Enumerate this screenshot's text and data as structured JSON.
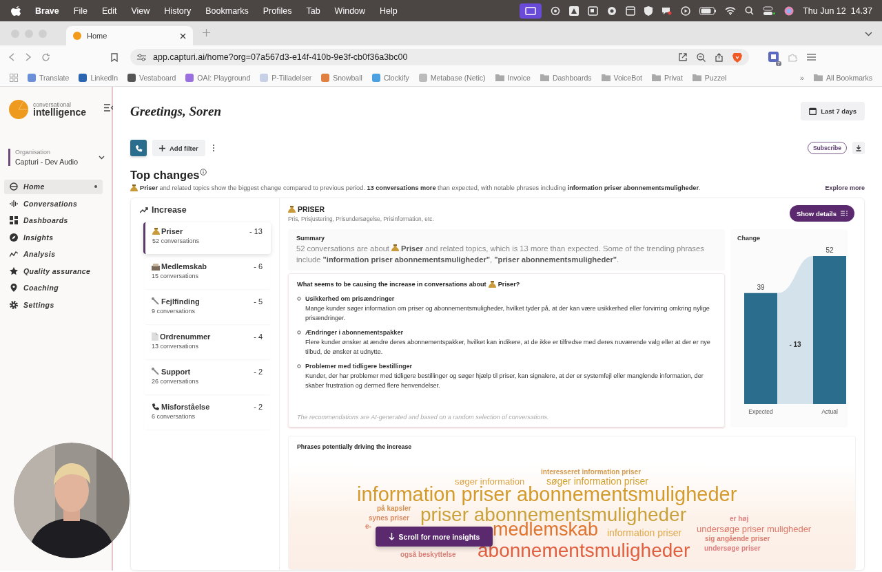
{
  "menubar": {
    "app": "Brave",
    "menus": [
      "File",
      "Edit",
      "View",
      "History",
      "Bookmarks",
      "Profiles",
      "Tab",
      "Window",
      "Help"
    ],
    "clock": "Thu Jun 12  14.37"
  },
  "browser": {
    "tabs": [
      {
        "title": "Home"
      }
    ],
    "url": "app.capturi.ai/home?org=07a567d3-e14f-410b-9e3f-cb0f36a3bc00",
    "extension_badge": "7",
    "bookmarks": [
      {
        "label": "Translate",
        "kind": "site"
      },
      {
        "label": "LinkedIn",
        "kind": "site"
      },
      {
        "label": "Vestaboard",
        "kind": "site"
      },
      {
        "label": "OAI: Playground",
        "kind": "site"
      },
      {
        "label": "P-Tilladelser",
        "kind": "site"
      },
      {
        "label": "Snowball",
        "kind": "site"
      },
      {
        "label": "Clockify",
        "kind": "site"
      },
      {
        "label": "Metabase (Netic)",
        "kind": "site"
      },
      {
        "label": "Invoice",
        "kind": "folder"
      },
      {
        "label": "Dashboards",
        "kind": "folder"
      },
      {
        "label": "VoiceBot",
        "kind": "folder"
      },
      {
        "label": "Privat",
        "kind": "folder"
      },
      {
        "label": "Puzzel",
        "kind": "folder"
      }
    ],
    "more_bookmarks": "»",
    "all_bookmarks": "All Bookmarks"
  },
  "sidebar": {
    "logo_small": "conversational",
    "logo_large": "intelligence",
    "org_label": "Organisation",
    "org_name": "Capturi - Dev Audio",
    "items": [
      {
        "label": "Home",
        "selected": true
      },
      {
        "label": "Conversations",
        "selected": false
      },
      {
        "label": "Dashboards",
        "selected": false
      },
      {
        "label": "Insights",
        "selected": false
      },
      {
        "label": "Analysis",
        "selected": false
      },
      {
        "label": "Quality assurance",
        "selected": false
      },
      {
        "label": "Coaching",
        "selected": false
      },
      {
        "label": "Settings",
        "selected": false
      }
    ]
  },
  "header": {
    "greeting": "Greetings, Soren",
    "date_range": "Last 7 days",
    "add_filter": "Add filter",
    "subscribe": "Subscribe"
  },
  "top_changes": {
    "title": "Top changes",
    "description": "**Priser** and related topics show the biggest change compared to previous period. **13 conversations more** than expected, with notable phrases including **information priser abonnementsmuligheder**.",
    "explore": "Explore more",
    "direction": "Increase",
    "topics": [
      {
        "name": "Priser",
        "count": "52 conversations",
        "change": "- 13",
        "selected": true
      },
      {
        "name": "Medlemskab",
        "count": "15 conversations",
        "change": "- 6",
        "selected": false
      },
      {
        "name": "Fejlfinding",
        "count": "9 conversations",
        "change": "- 5",
        "selected": false
      },
      {
        "name": "Ordrenummer",
        "count": "13 conversations",
        "change": "- 4",
        "selected": false
      },
      {
        "name": "Support",
        "count": "26 conversations",
        "change": "- 2",
        "selected": false
      },
      {
        "name": "Misforståelse",
        "count": "6 conversations",
        "change": "- 2",
        "selected": false
      }
    ],
    "detail": {
      "title": "PRISER",
      "subtitle": "Pris, Prisjustering, Prisundersøgelse, Prisinformation, etc.",
      "show_details": "Show details",
      "summary_title": "Summary",
      "summary_lead": "52 conversations are about",
      "summary_body": "**Priser** and related topics, which is 13 more than expected. Some of the trending phrases include **\"information priser abonnementsmuligheder\"**, **\"priser abonnementsmuligheder\"**.",
      "question_lead": "What seems to be causing the increase in conversations about",
      "question_topic": "Priser?",
      "causes": [
        {
          "title": "Usikkerhed om prisændringer",
          "text": "Mange kunder søger information om priser og abonnementsmuligheder, hvilket tyder på, at der kan være usikkerhed eller forvirring omkring nylige prisændringer."
        },
        {
          "title": "Ændringer i abonnementspakker",
          "text": "Flere kunder ønsker at ændre deres abonnementspakker, hvilket kan indikere, at de ikke er tilfredse med deres nuværende valg eller at der er nye tilbud, de ønsker at udnytte."
        },
        {
          "title": "Problemer med tidligere bestillinger",
          "text": "Kunder, der har problemer med tidligere bestillinger og søger hjælp til priser, kan signalere, at der er systemfejl eller manglende information, der skaber frustration og dermed flere henvendelser."
        }
      ],
      "disclaimer": "The recommendations are AI-generated and based on a random selection of conversations.",
      "change": {
        "chart_data": {
          "type": "bar",
          "title": "Change",
          "categories": [
            "Expected",
            "Actual"
          ],
          "values": [
            39,
            52
          ],
          "data_labels": true,
          "annotations": [
            {
              "text": "- 13"
            }
          ]
        }
      },
      "phrases": {
        "title": "Phrases potentially driving the increase",
        "words": [
          {
            "text": "interesseret information priser",
            "color": "#d49a50"
          },
          {
            "text": "søger information",
            "color": "#dca244"
          },
          {
            "text": "søger information priser",
            "color": "#d4a030"
          },
          {
            "text": "information priser abonnementsmuligheder",
            "color": "#d39a2c"
          },
          {
            "text": "på kapsler",
            "color": "#d49050"
          },
          {
            "text": "synes priser",
            "color": "#d88a60"
          },
          {
            "text": "priser abonnementsmuligheder",
            "color": "#c9a23c"
          },
          {
            "text": "er høj",
            "color": "#dc8080"
          },
          {
            "text": "e-",
            "color": "#d88060"
          },
          {
            "text": "medlemskab",
            "color": "#e07430"
          },
          {
            "text": "information priser",
            "color": "#e0a848"
          },
          {
            "text": "undersøge priser muligheder",
            "color": "#e07868"
          },
          {
            "text": "sig angående priser",
            "color": "#dc7c70"
          },
          {
            "text": "abonnementsmuligheder",
            "color": "#e06040"
          },
          {
            "text": "undersøge priser",
            "color": "#dc8080"
          },
          {
            "text": "også beskyttelse",
            "color": "#d88078"
          }
        ]
      }
    }
  },
  "scroll_button": "Scroll for more insights"
}
